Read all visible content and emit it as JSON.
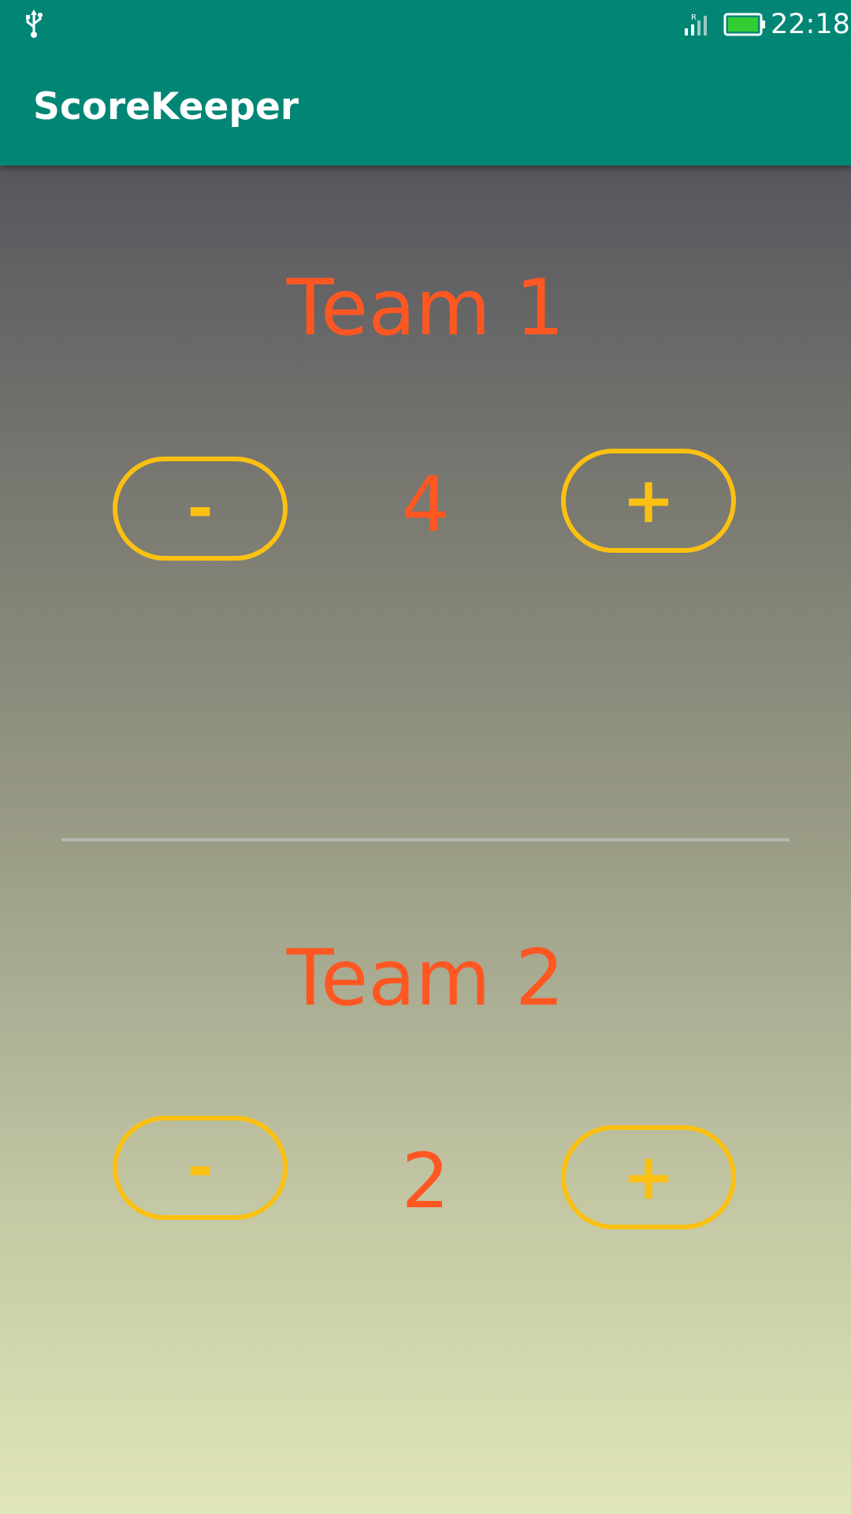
{
  "status_bar": {
    "time": "22:18",
    "icons": [
      "usb-icon",
      "signal-icon",
      "battery-icon"
    ],
    "signal_roaming_label": "R",
    "battery_color": "#33cc33"
  },
  "app_bar": {
    "title": "ScoreKeeper",
    "color": "#018675"
  },
  "teams": [
    {
      "name": "Team 1",
      "score": "4",
      "decrement_label": "-",
      "increment_label": "+"
    },
    {
      "name": "Team 2",
      "score": "2",
      "decrement_label": "-",
      "increment_label": "+"
    }
  ],
  "colors": {
    "text_accent": "#ff5722",
    "button_accent": "#fbc012"
  }
}
